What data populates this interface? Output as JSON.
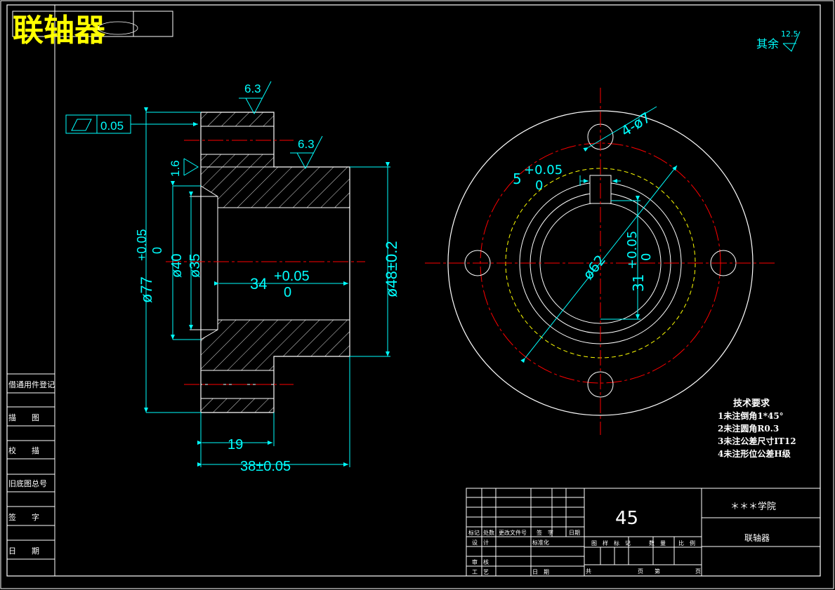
{
  "title": {
    "text": "联轴器",
    "stamp": ""
  },
  "colors": {
    "background": "#000000",
    "outline": "#ffffff",
    "dimension": "#00ffff",
    "center_line": "#ff0000",
    "hidden_circle": "#ffff00",
    "title": "#ffff00"
  },
  "roughness": {
    "default_label": "其余",
    "default_value": "12.5",
    "top_face": "6.3",
    "shoulder_face": "6.3",
    "bore_face": "1.6"
  },
  "tolerance_frame": {
    "value": "0.05"
  },
  "dimensions": {
    "outer_diameter_main": "ø77",
    "outer_diameter_upper": "+0.05",
    "outer_diameter_lower": "0",
    "bore_40": "ø40",
    "bore_35": "ø35",
    "length_34_main": "34",
    "length_34_upper": "+0.05",
    "length_34_lower": "0",
    "hub_diameter": "ø48±0.2",
    "flange_thickness": "19",
    "total_length": "38±0.05",
    "keyway_width_main": "5",
    "keyway_width_upper": "+0.05",
    "keyway_width_lower": "0",
    "bolt_circle": "ø62",
    "holes": "4-ø7",
    "keyway_depth_main": "31",
    "keyway_depth_upper": "+0.05",
    "keyway_depth_lower": "0"
  },
  "tech_requirements": {
    "heading": "技术要求",
    "items": [
      "1未注倒角1*45°",
      "2未注圆角R0.3",
      "3未注公差尺寸IT12",
      "4未注形位公差H级"
    ]
  },
  "left_column": {
    "labels": [
      "借通用件登记",
      "描　　图",
      "校　　描",
      "旧底图总号",
      "签　　字",
      "日　　期"
    ]
  },
  "title_block": {
    "material": "45",
    "school": "＊＊＊学院",
    "part_name": "联轴器",
    "row_headers": [
      "标记",
      "处数",
      "更改文件号",
      "签　字",
      "日期"
    ],
    "design": "设　计",
    "standard": "标准化",
    "stage_header": [
      "图　样　标　记",
      "数　量",
      "比　例"
    ],
    "check": "审　核",
    "process": "工　艺",
    "date": "日　期",
    "total": "共",
    "sheet": "页　　第",
    "page": "页"
  }
}
